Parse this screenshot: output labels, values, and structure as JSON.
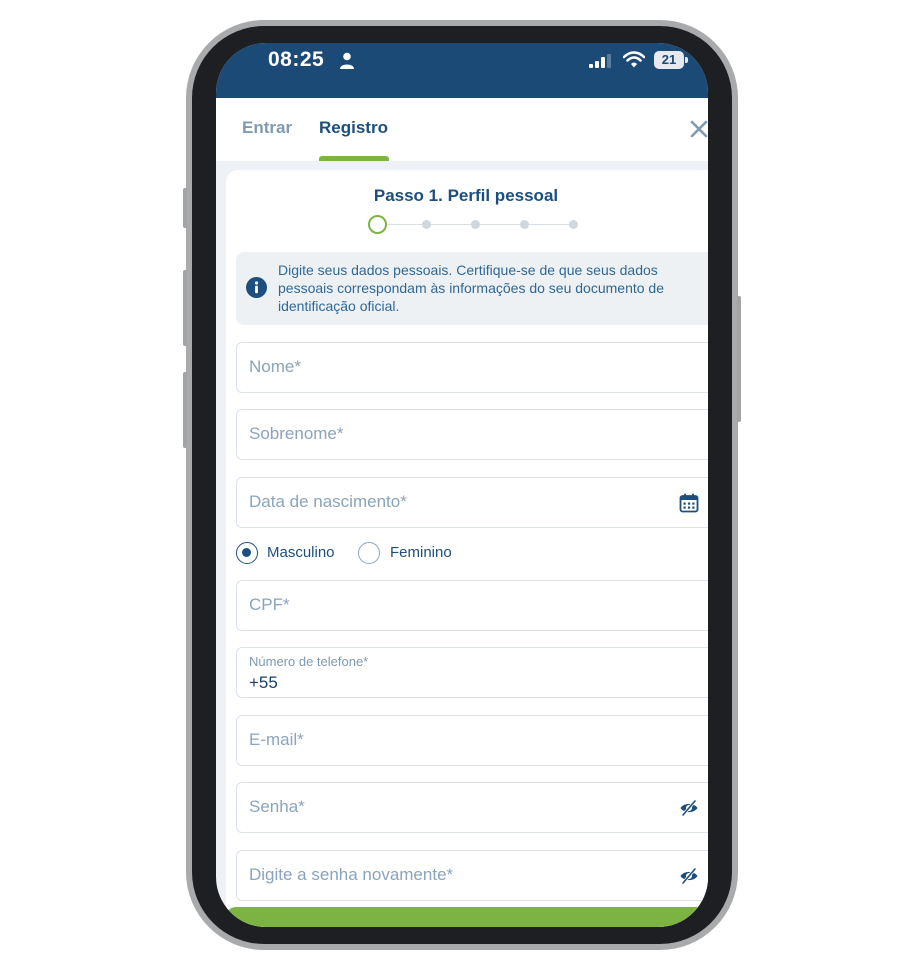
{
  "status_bar": {
    "time": "08:25",
    "battery": "21"
  },
  "tabs": [
    {
      "label": "Entrar",
      "active": false
    },
    {
      "label": "Registro",
      "active": true
    }
  ],
  "step": {
    "title": "Passo 1. Perfil pessoal",
    "current": 1,
    "total": 5
  },
  "info": {
    "text": "Digite seus dados pessoais. Certifique-se de que seus dados pessoais correspondam às informações do seu documento de identificação oficial."
  },
  "form": {
    "first_name": {
      "placeholder": "Nome*"
    },
    "last_name": {
      "placeholder": "Sobrenome*"
    },
    "birth_date": {
      "placeholder": "Data de nascimento*",
      "icon": "calendar-icon"
    },
    "gender": {
      "selected": "Masculino",
      "options": [
        "Masculino",
        "Feminino"
      ]
    },
    "cpf": {
      "placeholder": "CPF*"
    },
    "phone": {
      "label": "Número de telefone*",
      "value": "+55"
    },
    "email": {
      "placeholder": "E-mail*"
    },
    "password": {
      "placeholder": "Senha*",
      "icon": "eye-slash-icon"
    },
    "password_confirm": {
      "placeholder": "Digite a senha novamente*",
      "icon": "eye-slash-icon"
    }
  },
  "colors": {
    "primary": "#1d4f7e",
    "status_bar": "#1c4a77",
    "accent_green": "#7db343",
    "placeholder": "#8aa4bb"
  }
}
